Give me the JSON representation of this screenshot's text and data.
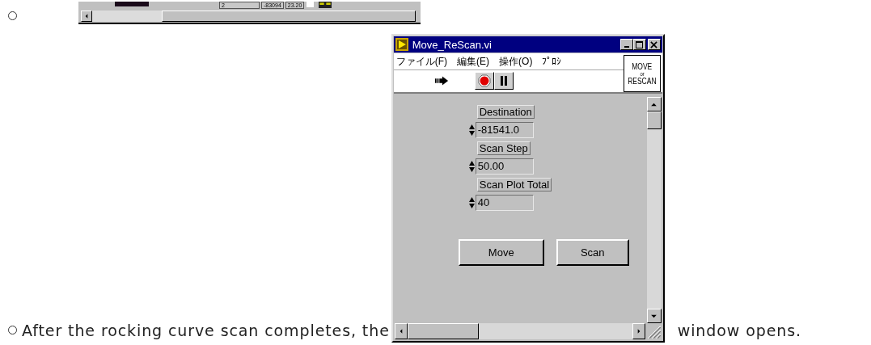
{
  "top_strip": {
    "fields": [
      "2",
      "-83094",
      "23.20"
    ]
  },
  "paragraph": {
    "text_before": "After the rocking curve scan completes, the",
    "text_after": "window opens."
  },
  "window": {
    "title": "Move_ReScan.vi",
    "menus": [
      "ファイル(F)",
      "編集(E)",
      "操作(O)",
      "ﾌﾟﾛｼ"
    ],
    "icon_lines": [
      "MOVE",
      "or",
      "RESCAN"
    ],
    "controls": [
      {
        "label": "Destination",
        "value": "-81541.0"
      },
      {
        "label": "Scan Step",
        "value": "50.00"
      },
      {
        "label": "Scan Plot Total",
        "value": "40"
      }
    ],
    "buttons": [
      "Move",
      "Scan"
    ]
  }
}
